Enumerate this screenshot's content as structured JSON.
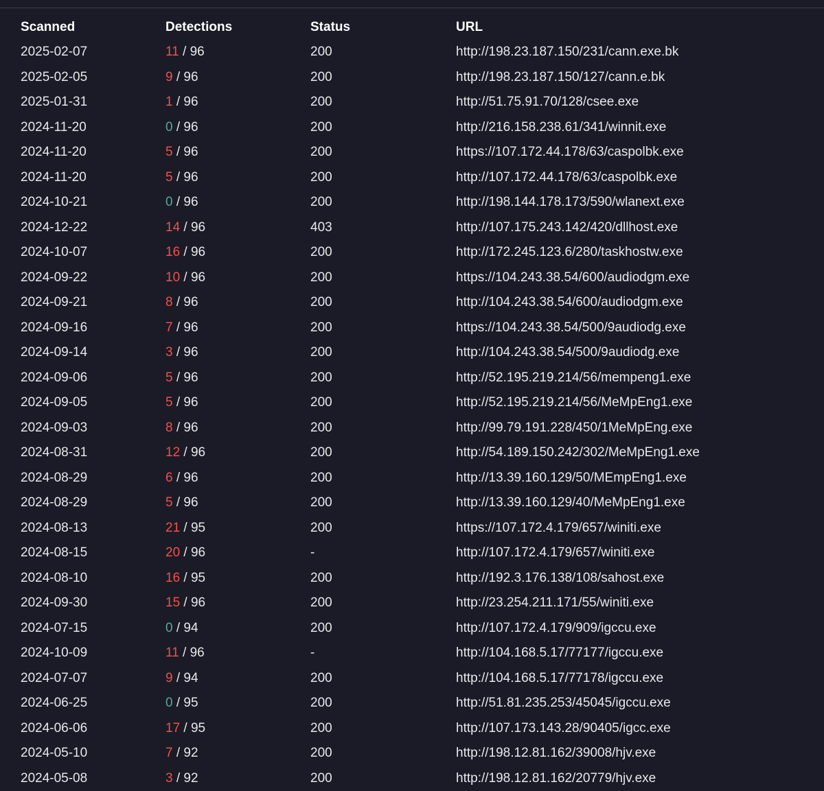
{
  "table": {
    "headers": {
      "scanned": "Scanned",
      "detections": "Detections",
      "status": "Status",
      "url": "URL"
    },
    "rows": [
      {
        "scanned": "2025-02-07",
        "detections": "11",
        "total": "/ 96",
        "status": "200",
        "url": "http://198.23.187.150/231/cann.exe.bk"
      },
      {
        "scanned": "2025-02-05",
        "detections": "9",
        "total": "/ 96",
        "status": "200",
        "url": "http://198.23.187.150/127/cann.e.bk"
      },
      {
        "scanned": "2025-01-31",
        "detections": "1",
        "total": "/ 96",
        "status": "200",
        "url": "http://51.75.91.70/128/csee.exe"
      },
      {
        "scanned": "2024-11-20",
        "detections": "0",
        "total": "/ 96",
        "status": "200",
        "url": "http://216.158.238.61/341/winnit.exe"
      },
      {
        "scanned": "2024-11-20",
        "detections": "5",
        "total": "/ 96",
        "status": "200",
        "url": "https://107.172.44.178/63/caspolbk.exe"
      },
      {
        "scanned": "2024-11-20",
        "detections": "5",
        "total": "/ 96",
        "status": "200",
        "url": "http://107.172.44.178/63/caspolbk.exe"
      },
      {
        "scanned": "2024-10-21",
        "detections": "0",
        "total": "/ 96",
        "status": "200",
        "url": "http://198.144.178.173/590/wlanext.exe"
      },
      {
        "scanned": "2024-12-22",
        "detections": "14",
        "total": "/ 96",
        "status": "403",
        "url": "http://107.175.243.142/420/dllhost.exe"
      },
      {
        "scanned": "2024-10-07",
        "detections": "16",
        "total": "/ 96",
        "status": "200",
        "url": "http://172.245.123.6/280/taskhostw.exe"
      },
      {
        "scanned": "2024-09-22",
        "detections": "10",
        "total": "/ 96",
        "status": "200",
        "url": "https://104.243.38.54/600/audiodgm.exe"
      },
      {
        "scanned": "2024-09-21",
        "detections": "8",
        "total": "/ 96",
        "status": "200",
        "url": "http://104.243.38.54/600/audiodgm.exe"
      },
      {
        "scanned": "2024-09-16",
        "detections": "7",
        "total": "/ 96",
        "status": "200",
        "url": "https://104.243.38.54/500/9audiodg.exe"
      },
      {
        "scanned": "2024-09-14",
        "detections": "3",
        "total": "/ 96",
        "status": "200",
        "url": "http://104.243.38.54/500/9audiodg.exe"
      },
      {
        "scanned": "2024-09-06",
        "detections": "5",
        "total": "/ 96",
        "status": "200",
        "url": "http://52.195.219.214/56/mempeng1.exe"
      },
      {
        "scanned": "2024-09-05",
        "detections": "5",
        "total": "/ 96",
        "status": "200",
        "url": "http://52.195.219.214/56/MeMpEng1.exe"
      },
      {
        "scanned": "2024-09-03",
        "detections": "8",
        "total": "/ 96",
        "status": "200",
        "url": "http://99.79.191.228/450/1MeMpEng.exe"
      },
      {
        "scanned": "2024-08-31",
        "detections": "12",
        "total": "/ 96",
        "status": "200",
        "url": "http://54.189.150.242/302/MeMpEng1.exe"
      },
      {
        "scanned": "2024-08-29",
        "detections": "6",
        "total": "/ 96",
        "status": "200",
        "url": "http://13.39.160.129/50/MEmpEng1.exe"
      },
      {
        "scanned": "2024-08-29",
        "detections": "5",
        "total": "/ 96",
        "status": "200",
        "url": "http://13.39.160.129/40/MeMpEng1.exe"
      },
      {
        "scanned": "2024-08-13",
        "detections": "21",
        "total": "/ 95",
        "status": "200",
        "url": "https://107.172.4.179/657/winiti.exe"
      },
      {
        "scanned": "2024-08-15",
        "detections": "20",
        "total": "/ 96",
        "status": "-",
        "url": "http://107.172.4.179/657/winiti.exe"
      },
      {
        "scanned": "2024-08-10",
        "detections": "16",
        "total": "/ 95",
        "status": "200",
        "url": "http://192.3.176.138/108/sahost.exe"
      },
      {
        "scanned": "2024-09-30",
        "detections": "15",
        "total": "/ 96",
        "status": "200",
        "url": "http://23.254.211.171/55/winiti.exe"
      },
      {
        "scanned": "2024-07-15",
        "detections": "0",
        "total": "/ 94",
        "status": "200",
        "url": "http://107.172.4.179/909/igccu.exe"
      },
      {
        "scanned": "2024-10-09",
        "detections": "11",
        "total": "/ 96",
        "status": "-",
        "url": "http://104.168.5.17/77177/igccu.exe"
      },
      {
        "scanned": "2024-07-07",
        "detections": "9",
        "total": "/ 94",
        "status": "200",
        "url": "http://104.168.5.17/77178/igccu.exe"
      },
      {
        "scanned": "2024-06-25",
        "detections": "0",
        "total": "/ 95",
        "status": "200",
        "url": "http://51.81.235.253/45045/igccu.exe"
      },
      {
        "scanned": "2024-06-06",
        "detections": "17",
        "total": "/ 95",
        "status": "200",
        "url": "http://107.173.143.28/90405/igcc.exe"
      },
      {
        "scanned": "2024-05-10",
        "detections": "7",
        "total": "/ 92",
        "status": "200",
        "url": "http://198.12.81.162/39008/hjv.exe"
      },
      {
        "scanned": "2024-05-08",
        "detections": "3",
        "total": "/ 92",
        "status": "200",
        "url": "http://198.12.81.162/20779/hjv.exe"
      }
    ]
  },
  "colors": {
    "background": "#1a1b26",
    "detection_positive": "#f2504b",
    "detection_zero": "#5aa89a",
    "text": "#e8e8ec"
  }
}
